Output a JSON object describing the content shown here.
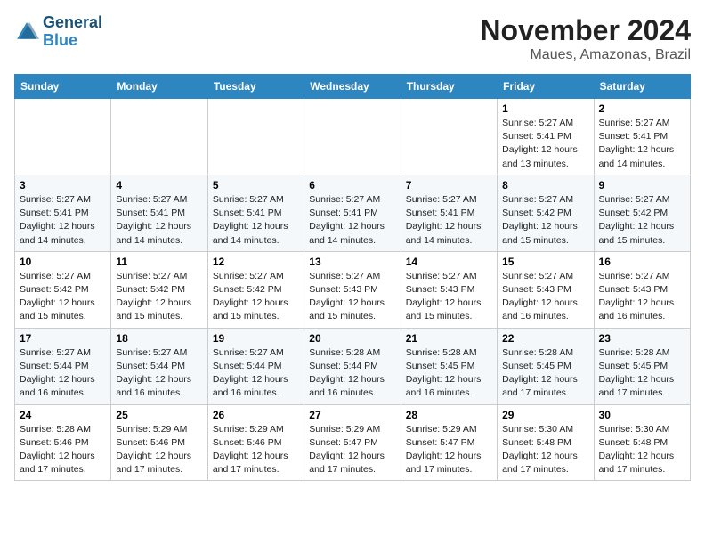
{
  "header": {
    "logo_line1": "General",
    "logo_line2": "Blue",
    "month": "November 2024",
    "location": "Maues, Amazonas, Brazil"
  },
  "weekdays": [
    "Sunday",
    "Monday",
    "Tuesday",
    "Wednesday",
    "Thursday",
    "Friday",
    "Saturday"
  ],
  "weeks": [
    [
      {
        "day": "",
        "info": ""
      },
      {
        "day": "",
        "info": ""
      },
      {
        "day": "",
        "info": ""
      },
      {
        "day": "",
        "info": ""
      },
      {
        "day": "",
        "info": ""
      },
      {
        "day": "1",
        "info": "Sunrise: 5:27 AM\nSunset: 5:41 PM\nDaylight: 12 hours\nand 13 minutes."
      },
      {
        "day": "2",
        "info": "Sunrise: 5:27 AM\nSunset: 5:41 PM\nDaylight: 12 hours\nand 14 minutes."
      }
    ],
    [
      {
        "day": "3",
        "info": "Sunrise: 5:27 AM\nSunset: 5:41 PM\nDaylight: 12 hours\nand 14 minutes."
      },
      {
        "day": "4",
        "info": "Sunrise: 5:27 AM\nSunset: 5:41 PM\nDaylight: 12 hours\nand 14 minutes."
      },
      {
        "day": "5",
        "info": "Sunrise: 5:27 AM\nSunset: 5:41 PM\nDaylight: 12 hours\nand 14 minutes."
      },
      {
        "day": "6",
        "info": "Sunrise: 5:27 AM\nSunset: 5:41 PM\nDaylight: 12 hours\nand 14 minutes."
      },
      {
        "day": "7",
        "info": "Sunrise: 5:27 AM\nSunset: 5:41 PM\nDaylight: 12 hours\nand 14 minutes."
      },
      {
        "day": "8",
        "info": "Sunrise: 5:27 AM\nSunset: 5:42 PM\nDaylight: 12 hours\nand 15 minutes."
      },
      {
        "day": "9",
        "info": "Sunrise: 5:27 AM\nSunset: 5:42 PM\nDaylight: 12 hours\nand 15 minutes."
      }
    ],
    [
      {
        "day": "10",
        "info": "Sunrise: 5:27 AM\nSunset: 5:42 PM\nDaylight: 12 hours\nand 15 minutes."
      },
      {
        "day": "11",
        "info": "Sunrise: 5:27 AM\nSunset: 5:42 PM\nDaylight: 12 hours\nand 15 minutes."
      },
      {
        "day": "12",
        "info": "Sunrise: 5:27 AM\nSunset: 5:42 PM\nDaylight: 12 hours\nand 15 minutes."
      },
      {
        "day": "13",
        "info": "Sunrise: 5:27 AM\nSunset: 5:43 PM\nDaylight: 12 hours\nand 15 minutes."
      },
      {
        "day": "14",
        "info": "Sunrise: 5:27 AM\nSunset: 5:43 PM\nDaylight: 12 hours\nand 15 minutes."
      },
      {
        "day": "15",
        "info": "Sunrise: 5:27 AM\nSunset: 5:43 PM\nDaylight: 12 hours\nand 16 minutes."
      },
      {
        "day": "16",
        "info": "Sunrise: 5:27 AM\nSunset: 5:43 PM\nDaylight: 12 hours\nand 16 minutes."
      }
    ],
    [
      {
        "day": "17",
        "info": "Sunrise: 5:27 AM\nSunset: 5:44 PM\nDaylight: 12 hours\nand 16 minutes."
      },
      {
        "day": "18",
        "info": "Sunrise: 5:27 AM\nSunset: 5:44 PM\nDaylight: 12 hours\nand 16 minutes."
      },
      {
        "day": "19",
        "info": "Sunrise: 5:27 AM\nSunset: 5:44 PM\nDaylight: 12 hours\nand 16 minutes."
      },
      {
        "day": "20",
        "info": "Sunrise: 5:28 AM\nSunset: 5:44 PM\nDaylight: 12 hours\nand 16 minutes."
      },
      {
        "day": "21",
        "info": "Sunrise: 5:28 AM\nSunset: 5:45 PM\nDaylight: 12 hours\nand 16 minutes."
      },
      {
        "day": "22",
        "info": "Sunrise: 5:28 AM\nSunset: 5:45 PM\nDaylight: 12 hours\nand 17 minutes."
      },
      {
        "day": "23",
        "info": "Sunrise: 5:28 AM\nSunset: 5:45 PM\nDaylight: 12 hours\nand 17 minutes."
      }
    ],
    [
      {
        "day": "24",
        "info": "Sunrise: 5:28 AM\nSunset: 5:46 PM\nDaylight: 12 hours\nand 17 minutes."
      },
      {
        "day": "25",
        "info": "Sunrise: 5:29 AM\nSunset: 5:46 PM\nDaylight: 12 hours\nand 17 minutes."
      },
      {
        "day": "26",
        "info": "Sunrise: 5:29 AM\nSunset: 5:46 PM\nDaylight: 12 hours\nand 17 minutes."
      },
      {
        "day": "27",
        "info": "Sunrise: 5:29 AM\nSunset: 5:47 PM\nDaylight: 12 hours\nand 17 minutes."
      },
      {
        "day": "28",
        "info": "Sunrise: 5:29 AM\nSunset: 5:47 PM\nDaylight: 12 hours\nand 17 minutes."
      },
      {
        "day": "29",
        "info": "Sunrise: 5:30 AM\nSunset: 5:48 PM\nDaylight: 12 hours\nand 17 minutes."
      },
      {
        "day": "30",
        "info": "Sunrise: 5:30 AM\nSunset: 5:48 PM\nDaylight: 12 hours\nand 17 minutes."
      }
    ]
  ]
}
